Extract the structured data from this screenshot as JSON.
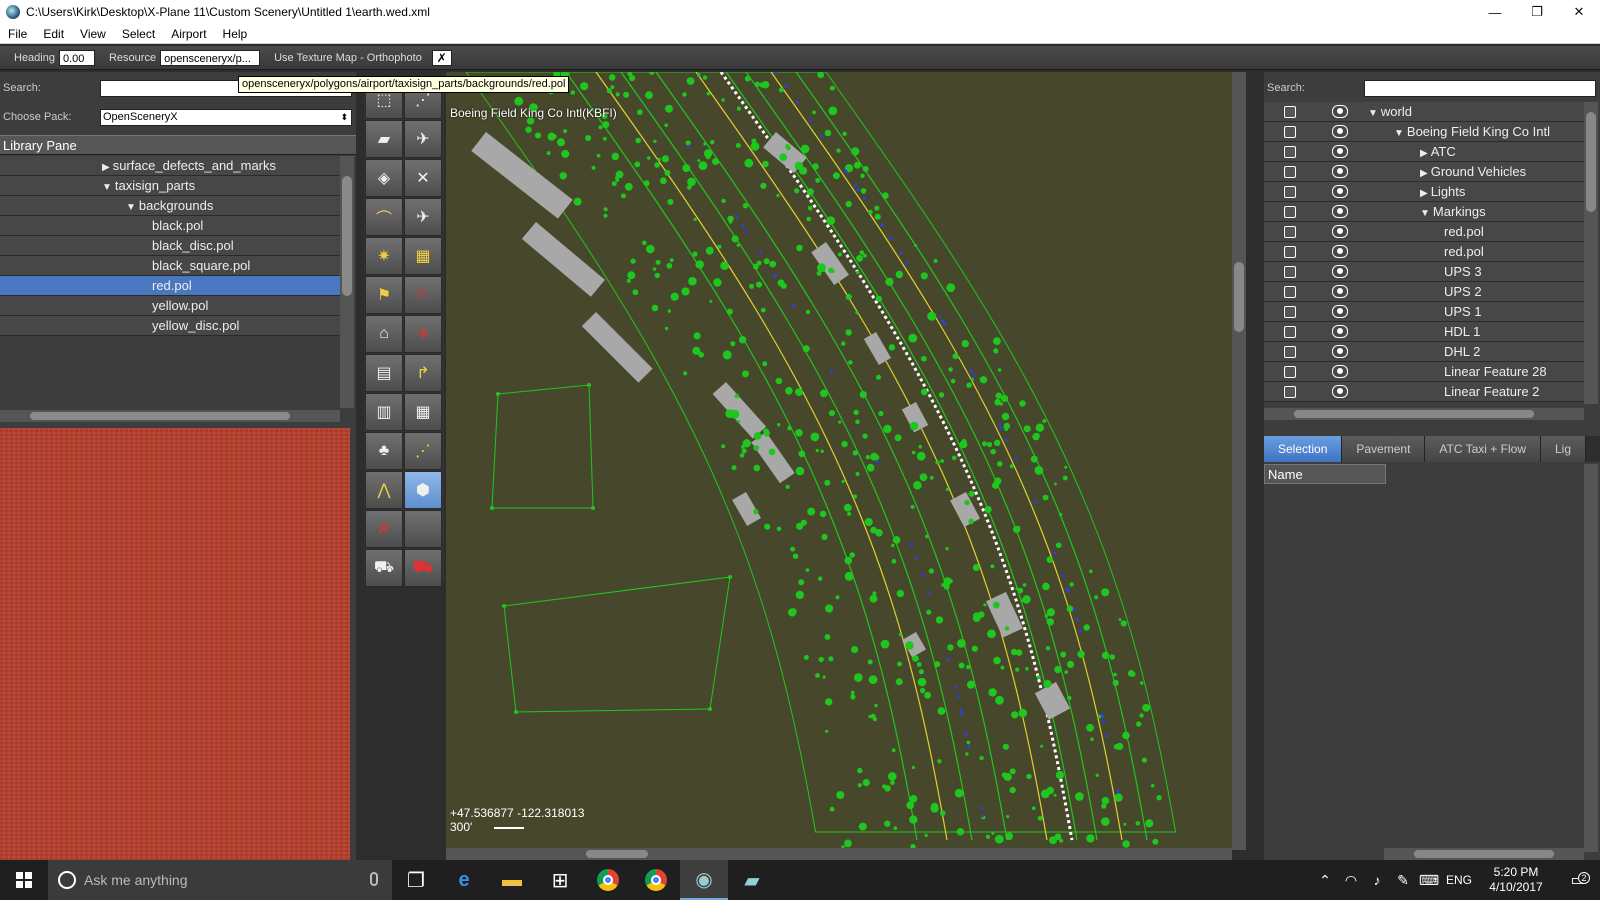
{
  "window": {
    "title": "C:\\Users\\Kirk\\Desktop\\X-Plane 11\\Custom Scenery\\Untitled 1\\earth.wed.xml",
    "minimize": "—",
    "maximize": "❐",
    "close": "✕"
  },
  "menu": [
    "File",
    "Edit",
    "View",
    "Select",
    "Airport",
    "Help"
  ],
  "options": {
    "heading_label": "Heading",
    "heading_value": "0.00",
    "resource_label": "Resource",
    "resource_value": "opensceneryx/p...",
    "texture_map_label": "Use Texture Map - Orthophoto",
    "texture_map_checked": "✗"
  },
  "tooltip": "opensceneryx/polygons/airport/taxisign_parts/backgrounds/red.pol",
  "library": {
    "search_label": "Search:",
    "search_value": "",
    "pack_label": "Choose Pack:",
    "pack_value": "OpenSceneryX",
    "header": "Library Pane",
    "items": [
      {
        "label": "surface_defects_and_marks",
        "indent": 102,
        "tri": "▶"
      },
      {
        "label": "taxisign_parts",
        "indent": 102,
        "tri": "▼"
      },
      {
        "label": "backgrounds",
        "indent": 126,
        "tri": "▼"
      },
      {
        "label": "black.pol",
        "indent": 152,
        "tri": ""
      },
      {
        "label": "black_disc.pol",
        "indent": 152,
        "tri": ""
      },
      {
        "label": "black_square.pol",
        "indent": 152,
        "tri": ""
      },
      {
        "label": "red.pol",
        "indent": 152,
        "tri": "",
        "selected": true
      },
      {
        "label": "yellow.pol",
        "indent": 152,
        "tri": ""
      },
      {
        "label": "yellow_disc.pol",
        "indent": 152,
        "tri": ""
      }
    ]
  },
  "map": {
    "airport_label": "Boeing Field King Co Intl(KBFI)",
    "coordinates": "+47.536877 -122.318013",
    "scale": "300'"
  },
  "hierarchy": {
    "search_label": "Search:",
    "search_value": "",
    "rows": [
      {
        "label": "world",
        "indent": 104,
        "tri": "▼"
      },
      {
        "label": "Boeing Field King Co Intl",
        "indent": 130,
        "tri": "▼"
      },
      {
        "label": "ATC",
        "indent": 156,
        "tri": "▶"
      },
      {
        "label": "Ground Vehicles",
        "indent": 156,
        "tri": "▶"
      },
      {
        "label": "Lights",
        "indent": 156,
        "tri": "▶"
      },
      {
        "label": "Markings",
        "indent": 156,
        "tri": "▼"
      },
      {
        "label": "red.pol",
        "indent": 180,
        "tri": ""
      },
      {
        "label": "red.pol",
        "indent": 180,
        "tri": ""
      },
      {
        "label": "UPS 3",
        "indent": 180,
        "tri": ""
      },
      {
        "label": "UPS 2",
        "indent": 180,
        "tri": ""
      },
      {
        "label": "UPS 1",
        "indent": 180,
        "tri": ""
      },
      {
        "label": "HDL 1",
        "indent": 180,
        "tri": ""
      },
      {
        "label": "DHL 2",
        "indent": 180,
        "tri": ""
      },
      {
        "label": "Linear Feature 28",
        "indent": 180,
        "tri": ""
      },
      {
        "label": "Linear Feature 2",
        "indent": 180,
        "tri": ""
      }
    ]
  },
  "tabs": [
    "Selection",
    "Pavement",
    "ATC Taxi + Flow",
    "Lig"
  ],
  "properties": {
    "name_header": "Name"
  },
  "taskbar": {
    "search_placeholder": "Ask me anything",
    "language": "ENG",
    "time": "5:20 PM",
    "date": "4/10/2017",
    "notification_count": "2"
  },
  "colors": {
    "map_background": "#47482b",
    "selection": "#4a78c0",
    "vegetation": "#1fc61f",
    "pavement": "#a8a8a8",
    "preview_texture": "#b9402e"
  }
}
